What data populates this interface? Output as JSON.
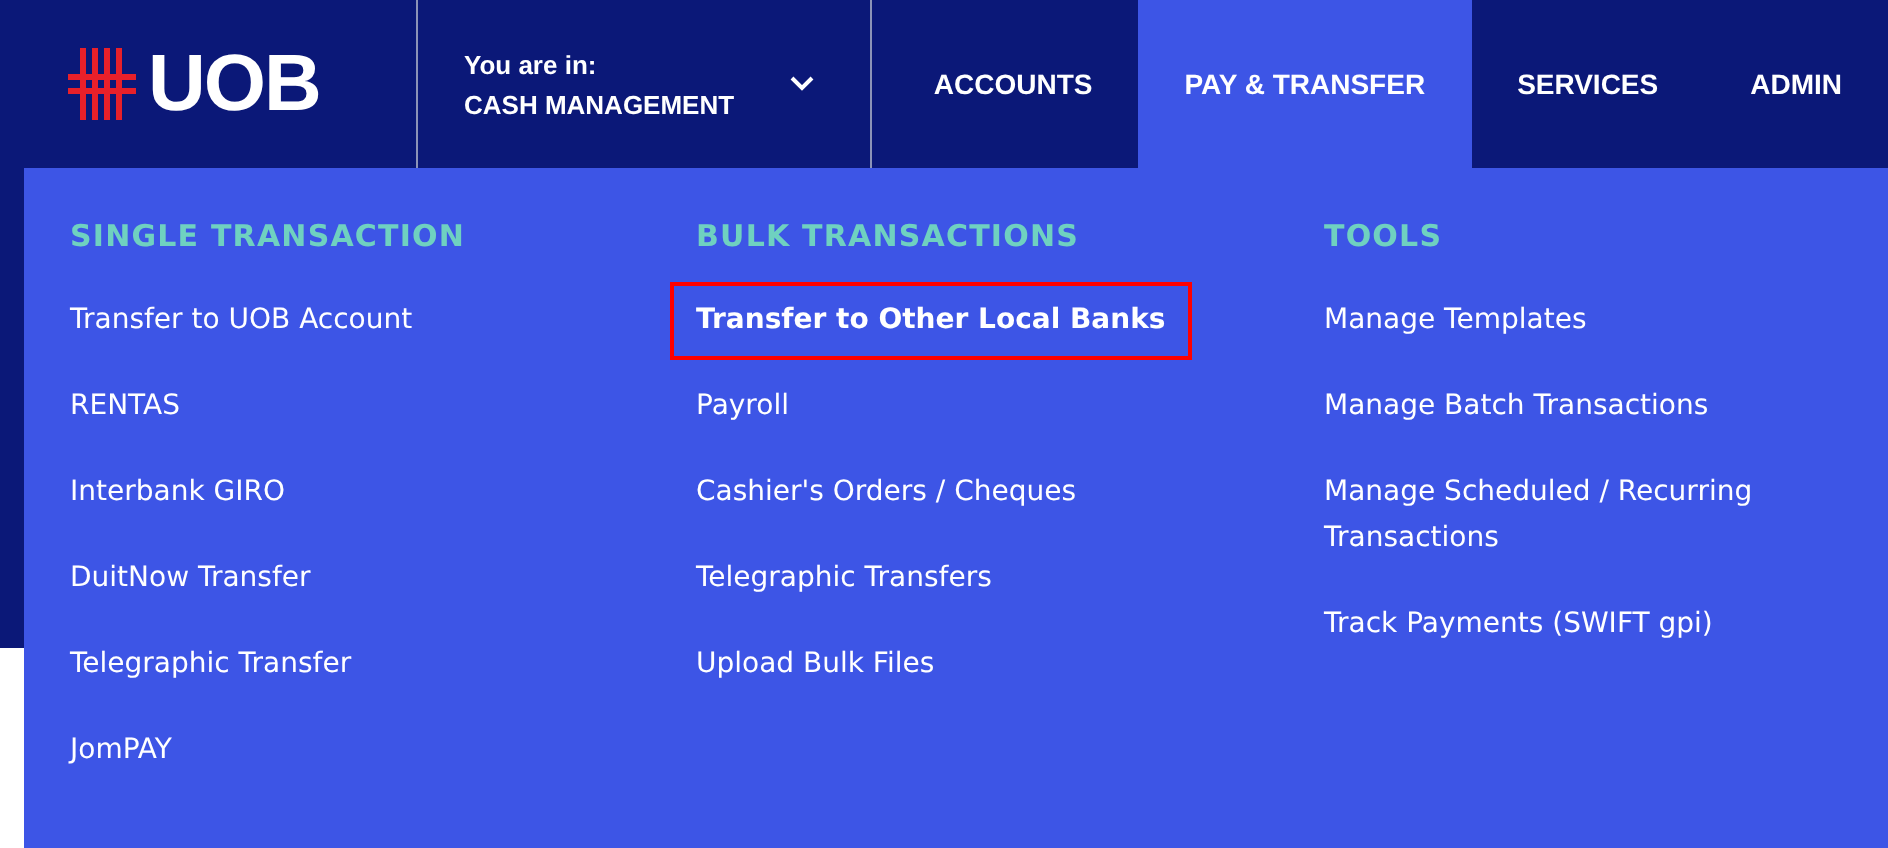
{
  "logo": "UOB",
  "context": {
    "label": "You are in:",
    "value": "CASH MANAGEMENT"
  },
  "tabs": [
    {
      "label": "ACCOUNTS",
      "selected": false
    },
    {
      "label": "PAY & TRANSFER",
      "selected": true
    },
    {
      "label": "SERVICES",
      "selected": false
    },
    {
      "label": "ADMIN",
      "selected": false
    }
  ],
  "menu_columns": [
    {
      "heading": "SINGLE TRANSACTION",
      "items": [
        {
          "label": "Transfer to UOB Account",
          "selected": false
        },
        {
          "label": "RENTAS",
          "selected": false
        },
        {
          "label": "Interbank GIRO",
          "selected": false
        },
        {
          "label": "DuitNow Transfer",
          "selected": false
        },
        {
          "label": "Telegraphic Transfer",
          "selected": false
        },
        {
          "label": "JomPAY",
          "selected": false
        }
      ]
    },
    {
      "heading": "BULK TRANSACTIONS",
      "items": [
        {
          "label": "Transfer to Other Local Banks",
          "selected": true
        },
        {
          "label": "Payroll",
          "selected": false
        },
        {
          "label": "Cashier's Orders / Cheques",
          "selected": false
        },
        {
          "label": "Telegraphic Transfers",
          "selected": false
        },
        {
          "label": "Upload Bulk Files",
          "selected": false
        }
      ]
    },
    {
      "heading": "TOOLS",
      "items": [
        {
          "label": "Manage Templates",
          "selected": false
        },
        {
          "label": "Manage Batch Transactions",
          "selected": false
        },
        {
          "label": "Manage Scheduled / Recurring Transactions",
          "selected": false
        },
        {
          "label": "Track Payments (SWIFT gpi)",
          "selected": false
        }
      ]
    }
  ]
}
